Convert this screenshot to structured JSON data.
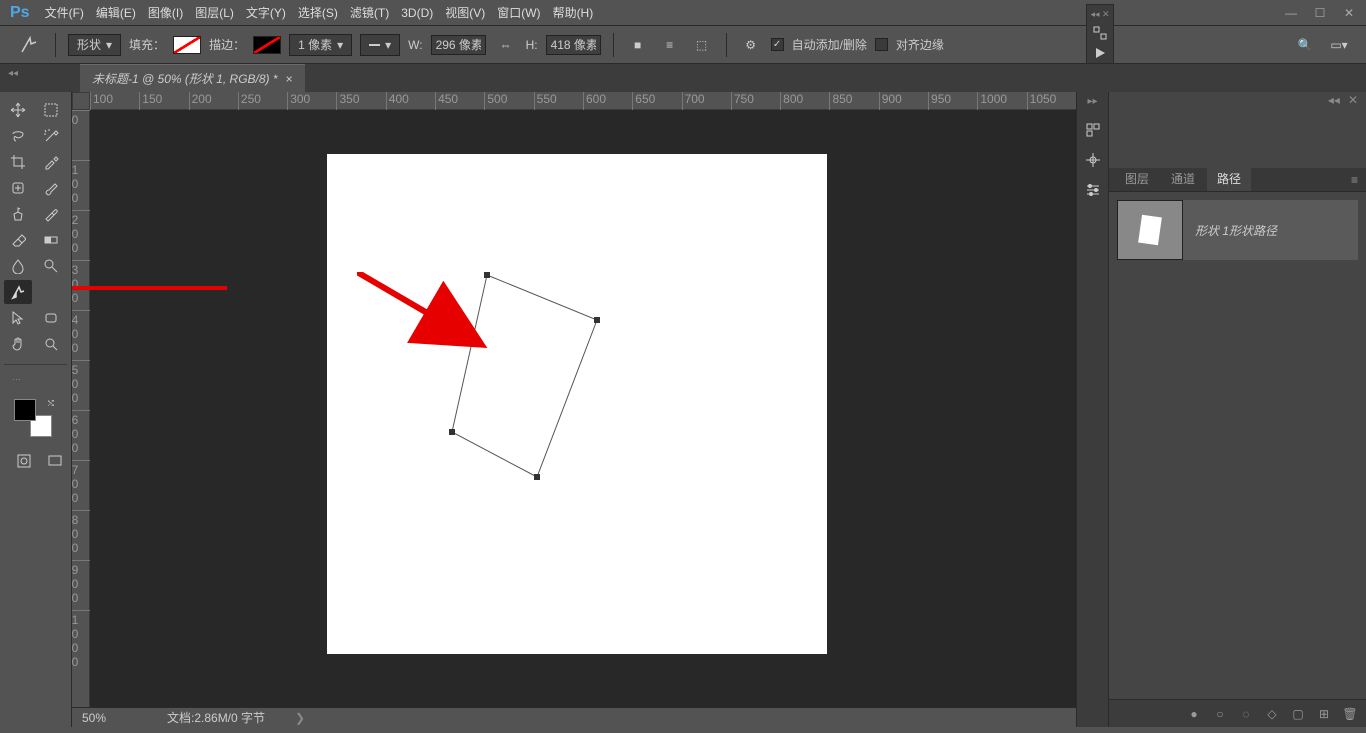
{
  "app": {
    "logo": "Ps"
  },
  "menu": [
    "文件(F)",
    "编辑(E)",
    "图像(I)",
    "图层(L)",
    "文字(Y)",
    "选择(S)",
    "滤镜(T)",
    "3D(D)",
    "视图(V)",
    "窗口(W)",
    "帮助(H)"
  ],
  "options": {
    "mode": "形状",
    "fill_label": "填充：",
    "stroke_label": "描边：",
    "stroke_width": "1 像素",
    "w_label": "W:",
    "w_value": "296 像素",
    "h_label": "H:",
    "h_value": "418 像素",
    "auto_label": "自动添加/删除",
    "align_label": "对齐边缘"
  },
  "tab": {
    "title": "未标题-1 @ 50% (形状 1, RGB/8) *"
  },
  "ruler_h": [
    "100",
    "150",
    "200",
    "250",
    "300",
    "350",
    "400",
    "450",
    "500",
    "550",
    "600",
    "650",
    "700",
    "750",
    "800",
    "850",
    "900",
    "950",
    "1000",
    "1050"
  ],
  "ruler_v": [
    "0",
    "100",
    "200",
    "300",
    "400",
    "500",
    "600",
    "700",
    "800",
    "900",
    "1000"
  ],
  "status": {
    "zoom": "50%",
    "doc": "文档:2.86M/0 字节"
  },
  "panels": {
    "tabs": [
      "图层",
      "通道",
      "路径"
    ],
    "active_tab": 2,
    "path_item": "形状 1形状路径"
  },
  "tool_names": [
    "move-tool",
    "rect-marquee-tool",
    "lasso-tool",
    "magic-wand-tool",
    "crop-tool",
    "eyedropper-tool",
    "spot-heal-tool",
    "brush-tool",
    "clone-tool",
    "history-brush-tool",
    "eraser-tool",
    "gradient-tool",
    "blur-tool",
    "dodge-tool",
    "pen-tool",
    "type-tool",
    "path-select-tool",
    "rectangle-tool",
    "hand-tool",
    "zoom-tool"
  ]
}
